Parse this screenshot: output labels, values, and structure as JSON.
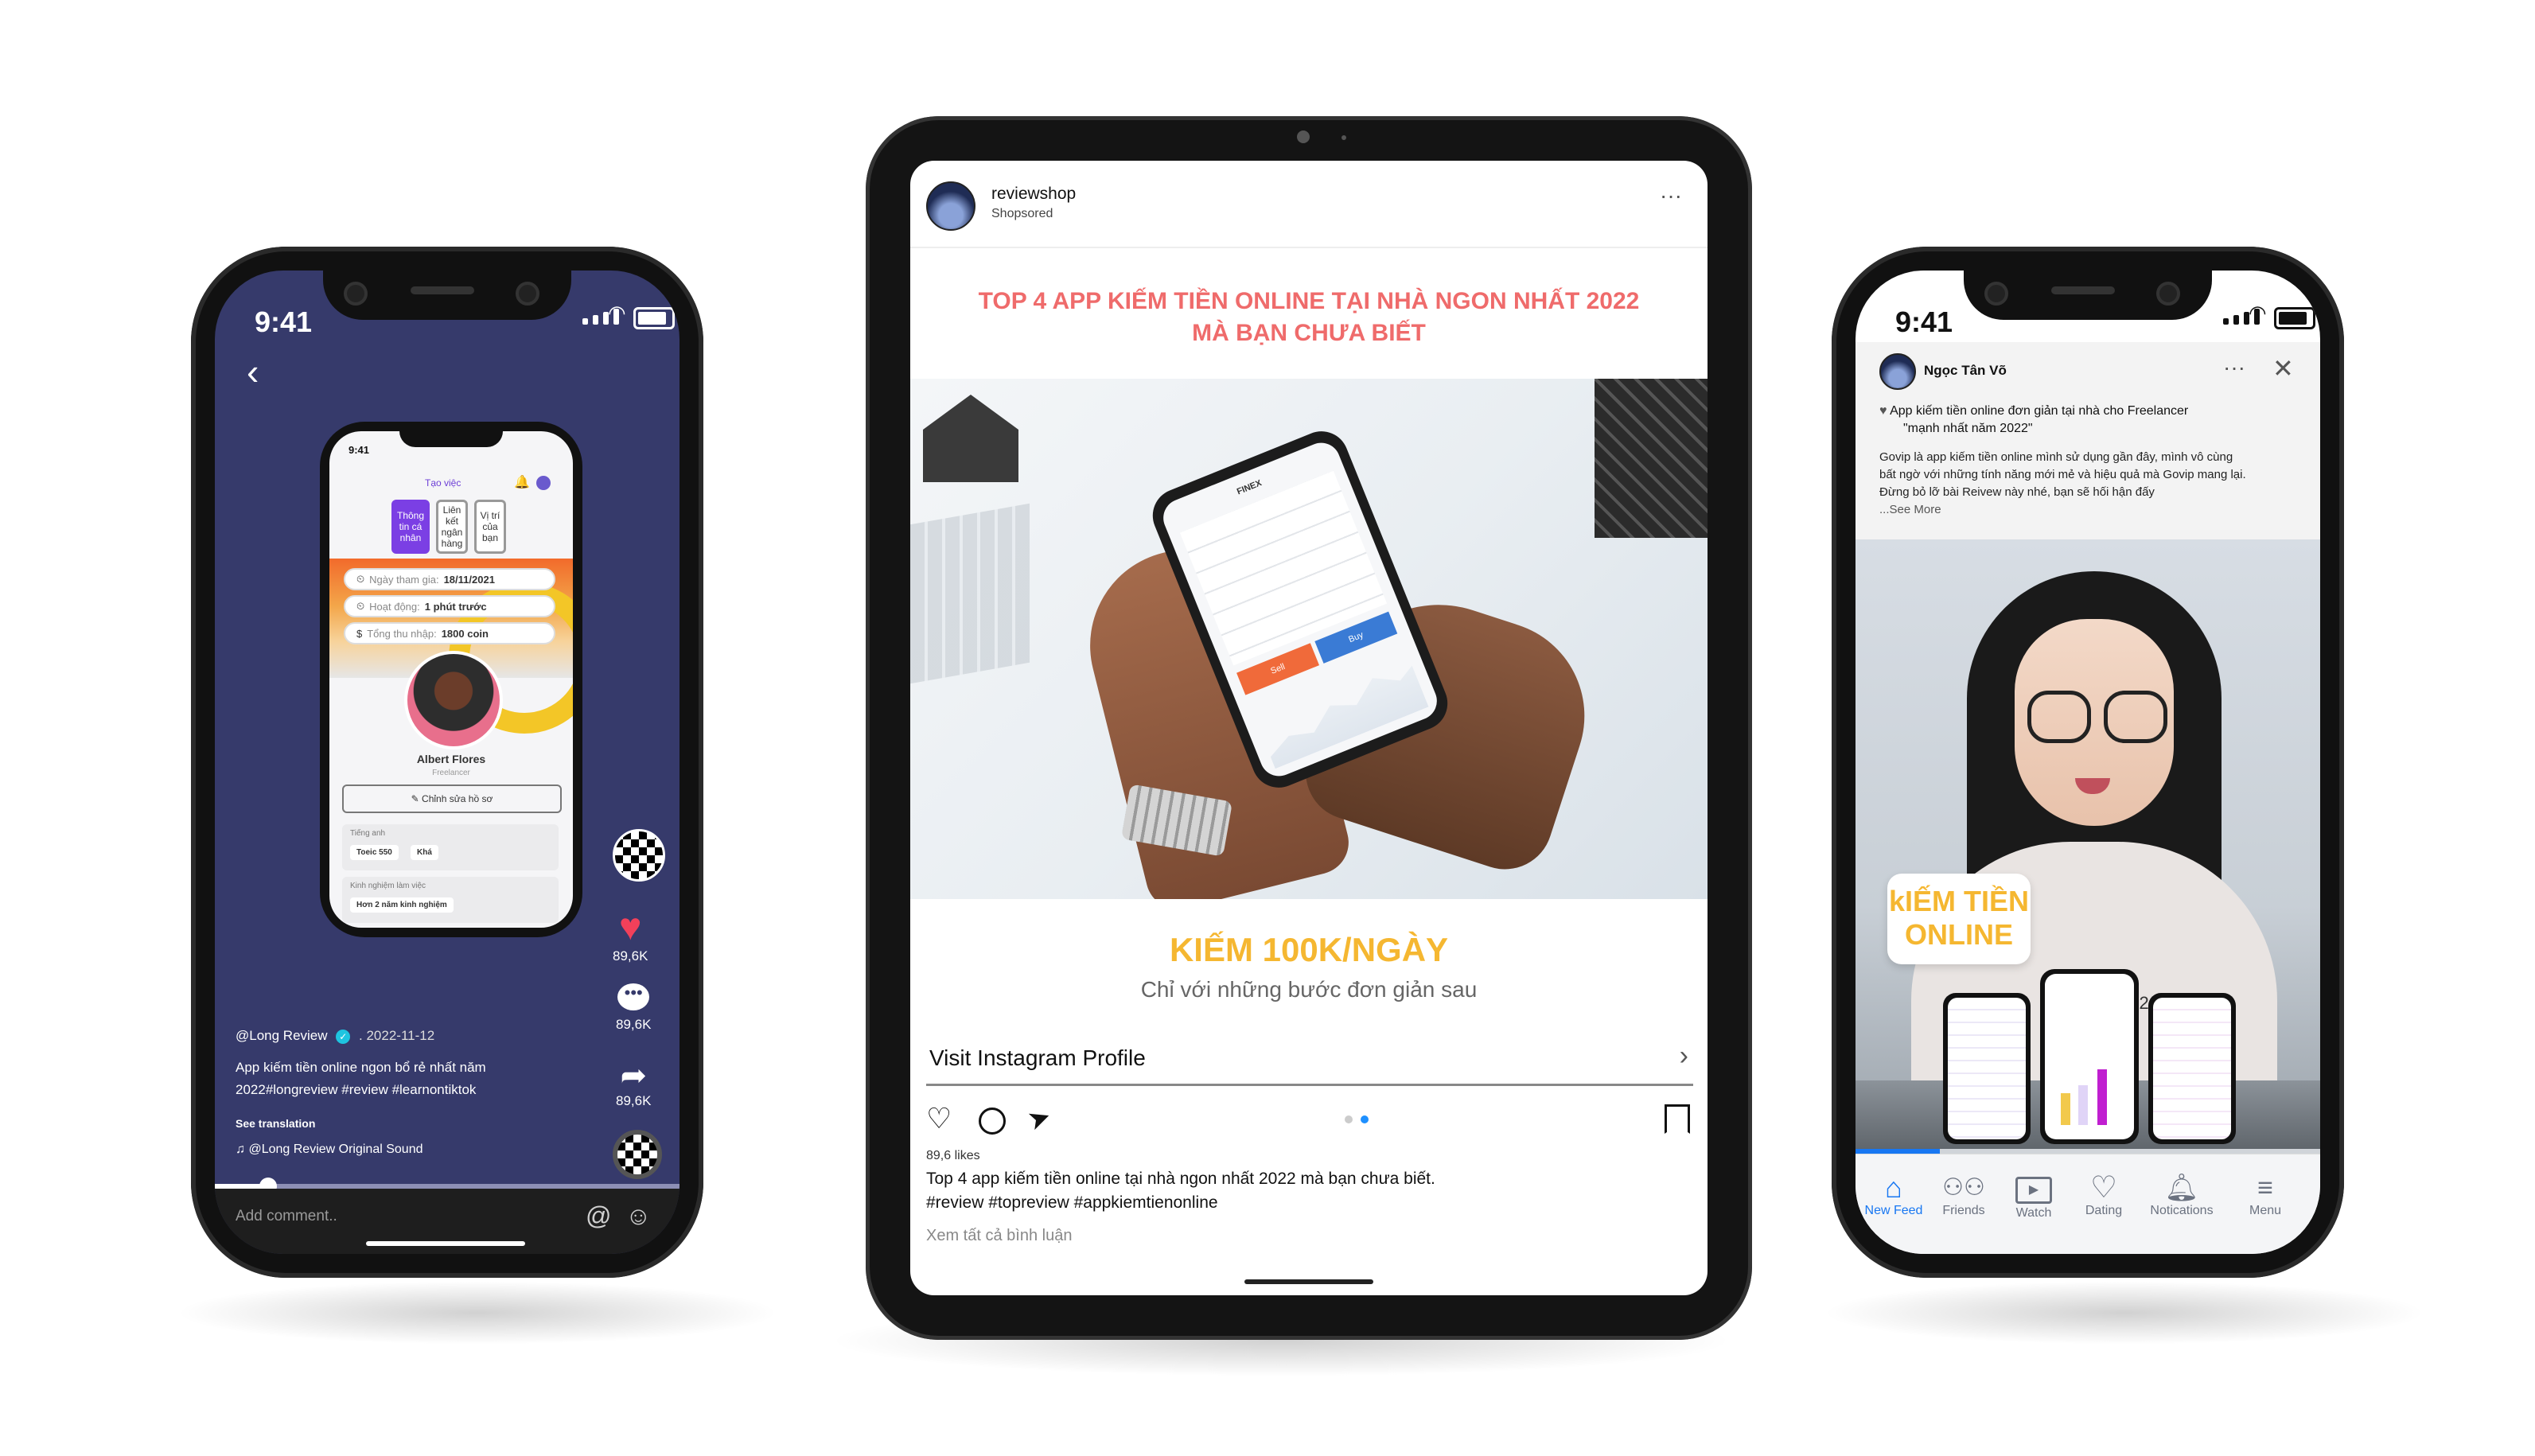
{
  "tiktok": {
    "time": "9:41",
    "mini": {
      "time": "9:41",
      "header": "Tạo việc",
      "tabs": [
        "Thông tin cá nhân",
        "Liên kết ngân hàng",
        "Vị trí của bạn"
      ],
      "rows": [
        {
          "label": "Ngày tham gia:",
          "value": "18/11/2021"
        },
        {
          "label": "Hoạt động:",
          "value": "1 phút trước"
        },
        {
          "label": "Tổng thu nhập:",
          "value": "1800 coin"
        }
      ],
      "name": "Albert Flores",
      "role": "Freelancer",
      "edit_button": "Chỉnh sửa hồ sơ",
      "lang_title": "Tiếng anh",
      "lang_values": [
        "Toeic 550",
        "Khá"
      ],
      "exp_title": "Kinh nghiệm làm việc",
      "exp_value": "Hơn 2 năm kinh nghiệm"
    },
    "likes": "89,6K",
    "comments": "89,6K",
    "shares": "89,6K",
    "username": "@Long Review",
    "date": ". 2022-11-12",
    "caption_line1": "App kiếm tiền online ngon bổ rẻ nhất năm",
    "caption_line2": "2022#longreview #review #learnontiktok",
    "see_translation": "See translation",
    "sound": "@Long Review Original Sound",
    "comment_placeholder": "Add comment.."
  },
  "instagram": {
    "account": "reviewshop",
    "sponsored": "Shopsored",
    "headline_line1": "TOP 4 APP KIẾM TIỀN ONLINE TẠI NHÀ NGON NHẤT 2022",
    "headline_line2": "MÀ BẠN CHƯA BIẾT",
    "banner_title": "KIẾM 100K/NGÀY",
    "banner_subtitle": "Chỉ với những bước đơn giản sau",
    "visit_profile": "Visit Instagram Profile",
    "likes": "89,6 likes",
    "caption": "Top 4 app kiếm tiền online tại nhà ngon nhất 2022 mà bạn chưa biết.",
    "hashtags": "#review #topreview #appkiemtienonline",
    "view_comments": "Xem tất cả bình luận",
    "mock_app": {
      "brand": "FINEX",
      "sell": "Sell",
      "buy": "Buy"
    }
  },
  "facebook": {
    "time": "9:41",
    "author": "Ngọc Tân Võ",
    "title_line1": "App kiếm tiền online đơn giản tại nhà cho Freelancer",
    "title_line2": "\"mạnh nhất năm 2022\"",
    "body_line1": "Govip là app kiếm tiền online mình sử dụng gần đây, mình vô cùng",
    "body_line2": "bất ngờ với những tính năng mới mẻ và hiệu quả mà Govip mang lại.",
    "body_line3": "Đừng bỏ lỡ bài Reivew này nhé, bạn sẽ hối hận đấy",
    "see_more": "...See More",
    "sticker_line1": "kIẾM TIỀN",
    "sticker_line2": "ONLINE",
    "shirt_text": "1927",
    "nav": [
      "New Feed",
      "Friends",
      "Watch",
      "Dating",
      "Notications",
      "Menu"
    ]
  },
  "colors": {
    "tiktok_bg": "#363a6b",
    "instagram_headline": "#ef6b6b",
    "banner_title": "#f5b731",
    "facebook_blue": "#1877f2",
    "sticker_text": "#f5b731",
    "like_red": "#f2405a"
  }
}
